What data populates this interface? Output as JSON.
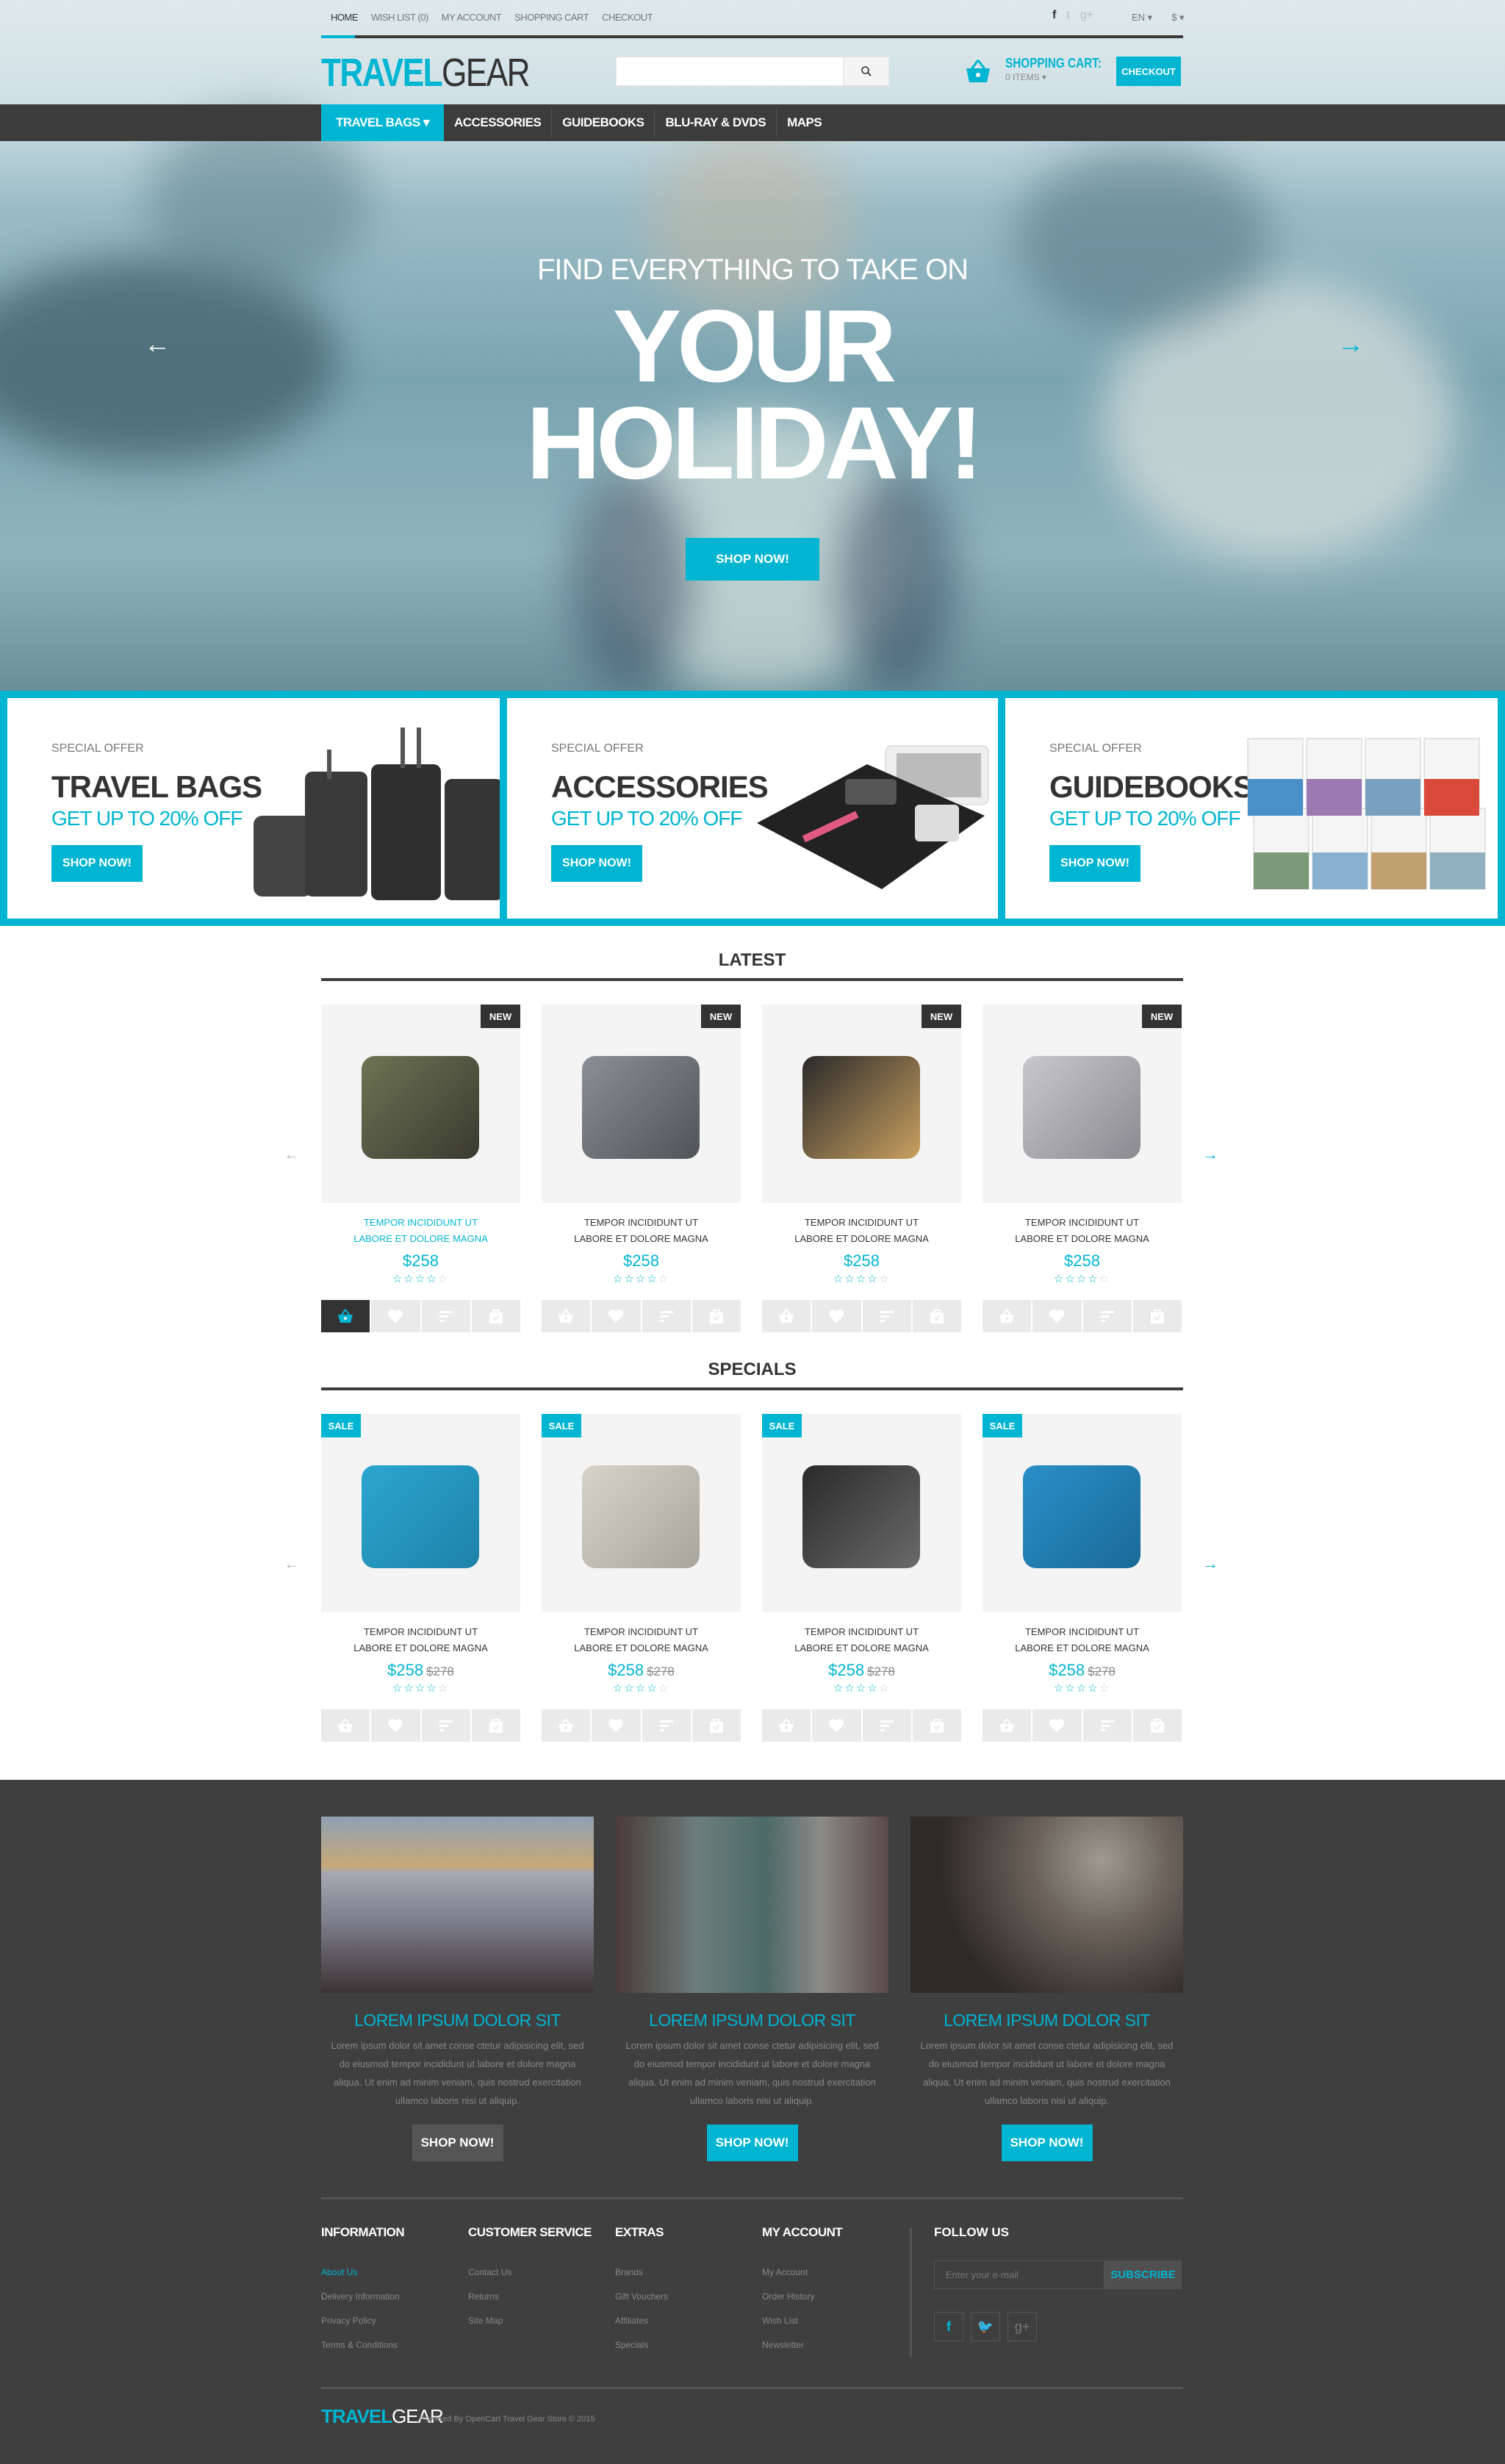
{
  "brand": {
    "part1": "TRAVEL",
    "part2": "GEAR"
  },
  "topbar": {
    "links": [
      "HOME",
      "WISH LIST (0)",
      "MY ACCOUNT",
      "SHOPPING CART",
      "CHECKOUT"
    ],
    "social": [
      "f",
      "t",
      "g+"
    ],
    "language": "EN ▾",
    "currency": "$ ▾"
  },
  "search": {
    "placeholder": "",
    "value": "",
    "icon": "search-icon"
  },
  "cart": {
    "title": "SHOPPING CART:",
    "items": "0 ITEMS ▾",
    "checkout_label": "CHECKOUT"
  },
  "nav": {
    "items": [
      "TRAVEL BAGS ▾",
      "ACCESSORIES",
      "GUIDEBOOKS",
      "BLU-RAY & DVDS",
      "MAPS"
    ],
    "active": 0
  },
  "hero": {
    "subtitle": "FIND EVERYTHING TO TAKE ON",
    "title_line1": "YOUR",
    "title_line2": "HOLIDAY!",
    "button": "SHOP NOW!",
    "prev": "←",
    "next": "→"
  },
  "banners": [
    {
      "label": "SPECIAL OFFER",
      "title": "TRAVEL BAGS",
      "offer": "GET UP TO 20% OFF",
      "button": "SHOP NOW!"
    },
    {
      "label": "SPECIAL OFFER",
      "title": "ACCESSORIES",
      "offer": "GET UP TO 20% OFF",
      "button": "SHOP NOW!"
    },
    {
      "label": "SPECIAL OFFER",
      "title": "GUIDEBOOKS",
      "offer": "GET UP TO 20% OFF",
      "button": "SHOP NOW!"
    }
  ],
  "latest": {
    "title": "LATEST",
    "prev": "←",
    "next": "→",
    "products": [
      {
        "badge": "NEW",
        "name": "TEMPOR INCIDIDUNT UT LABORE ET DOLORE MAGNA",
        "price": "$258",
        "rating": 4,
        "image": "duffel-bag"
      },
      {
        "badge": "NEW",
        "name": "TEMPOR INCIDIDUNT UT LABORE ET DOLORE MAGNA",
        "price": "$258",
        "rating": 4,
        "image": "rolling-backpack"
      },
      {
        "badge": "NEW",
        "name": "TEMPOR INCIDIDUNT UT LABORE ET DOLORE MAGNA",
        "price": "$258",
        "rating": 4,
        "image": "card-wallet"
      },
      {
        "badge": "NEW",
        "name": "TEMPOR INCIDIDUNT UT LABORE ET DOLORE MAGNA",
        "price": "$258",
        "rating": 4,
        "image": "combination-locks"
      }
    ]
  },
  "specials": {
    "title": "SPECIALS",
    "prev": "←",
    "next": "→",
    "products": [
      {
        "badge": "SALE",
        "name": "TEMPOR INCIDIDUNT UT LABORE ET DOLORE MAGNA",
        "price": "$258",
        "old_price": "$278",
        "rating": 4,
        "image": "toiletry-kit"
      },
      {
        "badge": "SALE",
        "name": "TEMPOR INCIDIDUNT UT LABORE ET DOLORE MAGNA",
        "price": "$258",
        "old_price": "$278",
        "rating": 4,
        "image": "waist-pack"
      },
      {
        "badge": "SALE",
        "name": "TEMPOR INCIDIDUNT UT LABORE ET DOLORE MAGNA",
        "price": "$258",
        "old_price": "$278",
        "rating": 4,
        "image": "packing-cube"
      },
      {
        "badge": "SALE",
        "name": "TEMPOR INCIDIDUNT UT LABORE ET DOLORE MAGNA",
        "price": "$258",
        "old_price": "$278",
        "rating": 4,
        "image": "travel-wallet"
      }
    ]
  },
  "product_actions": [
    "add-to-cart",
    "wishlist",
    "compare",
    "quick-view"
  ],
  "stories": [
    {
      "title": "LOREM IPSUM DOLOR SIT",
      "text": "Lorem ipsum dolor sit amet conse ctetur adipisicing elit, sed do eiusmod tempor incididunt ut labore et dolore magna aliqua. Ut enim ad minim veniam, quis nostrud exercitation ullamco laboris nisi ut aliquip.",
      "button": "SHOP NOW!"
    },
    {
      "title": "LOREM IPSUM DOLOR SIT",
      "text": "Lorem ipsum dolor sit amet conse ctetur adipisicing elit, sed do eiusmod tempor incididunt ut labore et dolore magna aliqua. Ut enim ad minim veniam, quis nostrud exercitation ullamco laboris nisi ut aliquip.",
      "button": "SHOP NOW!"
    },
    {
      "title": "LOREM IPSUM DOLOR SIT",
      "text": "Lorem ipsum dolor sit amet conse ctetur adipisicing elit, sed do eiusmod tempor incididunt ut labore et dolore magna aliqua. Ut enim ad minim veniam, quis nostrud exercitation ullamco laboris nisi ut aliquip.",
      "button": "SHOP NOW!"
    }
  ],
  "footer": {
    "columns": [
      {
        "title": "INFORMATION",
        "links": [
          "About Us",
          "Delivery Information",
          "Privacy Policy",
          "Terms & Conditions"
        ]
      },
      {
        "title": "CUSTOMER SERVICE",
        "links": [
          "Contact Us",
          "Returns",
          "Site Map"
        ]
      },
      {
        "title": "EXTRAS",
        "links": [
          "Brands",
          "Gift Vouchers",
          "Affiliates",
          "Specials"
        ]
      },
      {
        "title": "MY ACCOUNT",
        "links": [
          "My Account",
          "Order History",
          "Wish List",
          "Newsletter"
        ]
      }
    ],
    "follow": {
      "title": "FOLLOW US",
      "email_placeholder": "Enter your e-mail",
      "subscribe": "SUBSCRIBE",
      "social": [
        "f",
        "t",
        "g+"
      ]
    },
    "copyright": "Powered By OpenCart Travel Gear Store © 2015"
  },
  "colors": {
    "accent": "#00b5d1",
    "dark": "#3c3c3c",
    "footer_bg": "#3f3f3f"
  }
}
